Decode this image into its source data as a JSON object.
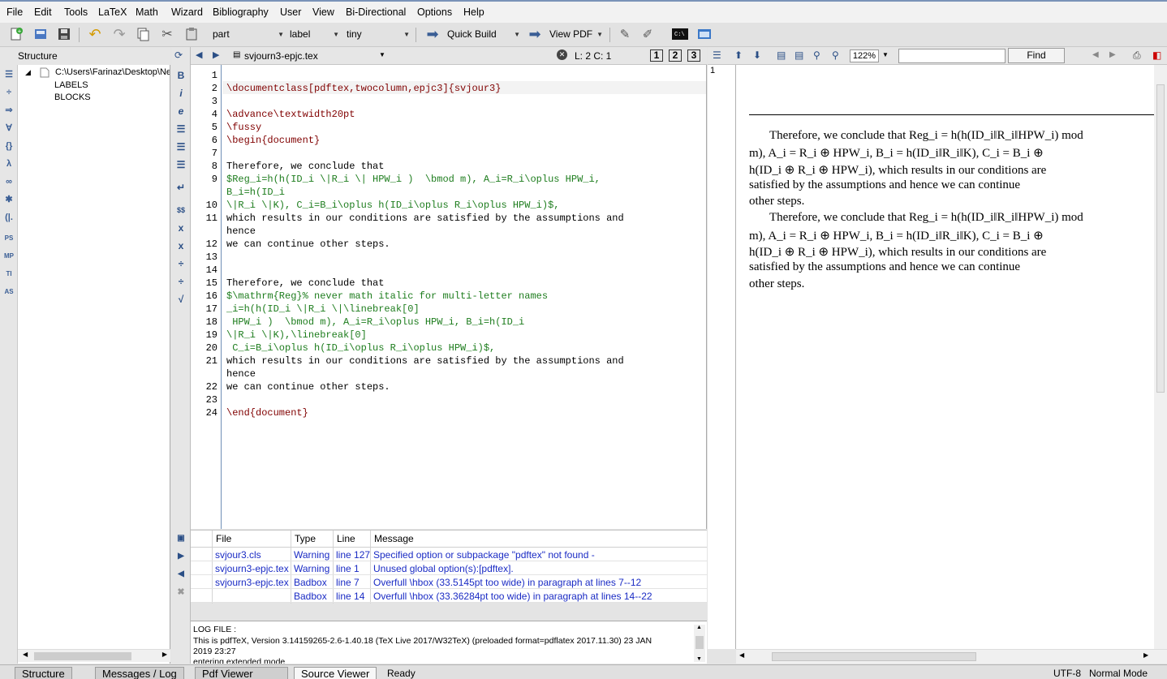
{
  "menu": [
    "File",
    "Edit",
    "Tools",
    "LaTeX",
    "Math",
    "Wizard",
    "Bibliography",
    "User",
    "View",
    "Bi-Directional",
    "Options",
    "Help"
  ],
  "toolbar": {
    "combo_part": "part",
    "combo_label": "label",
    "combo_size": "tiny",
    "quick_build": "Quick Build",
    "view_pdf": "View PDF"
  },
  "structure": {
    "title": "Structure",
    "root_path": "C:\\Users\\Farinaz\\Desktop\\Ne",
    "children": [
      "LABELS",
      "BLOCKS"
    ]
  },
  "editor": {
    "filename": "svjourn3-epjc.tex",
    "position": "L: 2 C: 1",
    "view_buttons": [
      "1",
      "2",
      "3"
    ],
    "lines": [
      {
        "n": "1",
        "text": ""
      },
      {
        "n": "2",
        "text": "\\documentclass[pdftex,twocolumn,epjc3]{svjour3}"
      },
      {
        "n": "3",
        "text": ""
      },
      {
        "n": "4",
        "text": "\\advance\\textwidth20pt"
      },
      {
        "n": "5",
        "text": "\\fussy"
      },
      {
        "n": "6",
        "text": "\\begin{document}"
      },
      {
        "n": "7",
        "text": ""
      },
      {
        "n": "8",
        "text": "Therefore, we conclude that"
      },
      {
        "n": "9",
        "text": "$Reg_i=h(h(ID_i \\|R_i \\| HPW_i )  \\bmod m), A_i=R_i\\oplus HPW_i,"
      },
      {
        "n": "",
        "text": "B_i=h(ID_i"
      },
      {
        "n": "10",
        "text": "\\|R_i \\|K), C_i=B_i\\oplus h(ID_i\\oplus R_i\\oplus HPW_i)$,"
      },
      {
        "n": "11",
        "text": "which results in our conditions are satisfied by the assumptions and"
      },
      {
        "n": "",
        "text": "hence"
      },
      {
        "n": "12",
        "text": "we can continue other steps."
      },
      {
        "n": "13",
        "text": ""
      },
      {
        "n": "14",
        "text": ""
      },
      {
        "n": "15",
        "text": "Therefore, we conclude that"
      },
      {
        "n": "16",
        "text": "$\\mathrm{Reg}% never math italic for multi-letter names"
      },
      {
        "n": "17",
        "text": "_i=h(h(ID_i \\|R_i \\|\\linebreak[0]"
      },
      {
        "n": "18",
        "text": " HPW_i )  \\bmod m), A_i=R_i\\oplus HPW_i, B_i=h(ID_i"
      },
      {
        "n": "19",
        "text": "\\|R_i \\|K),\\linebreak[0]"
      },
      {
        "n": "20",
        "text": " C_i=B_i\\oplus h(ID_i\\oplus R_i\\oplus HPW_i)$,"
      },
      {
        "n": "21",
        "text": "which results in our conditions are satisfied by the assumptions and"
      },
      {
        "n": "",
        "text": "hence"
      },
      {
        "n": "22",
        "text": "we can continue other steps."
      },
      {
        "n": "23",
        "text": ""
      },
      {
        "n": "24",
        "text": "\\end{document}"
      }
    ]
  },
  "messages": {
    "headers": [
      "File",
      "Type",
      "Line",
      "Message"
    ],
    "rows": [
      {
        "file": "svjour3.cls",
        "type": "Warning",
        "line": "line 127",
        "message": "Specified option or subpackage \"pdftex\" not found -"
      },
      {
        "file": "svjourn3-epjc.tex",
        "type": "Warning",
        "line": "line 1",
        "message": "Unused global option(s):[pdftex]."
      },
      {
        "file": "svjourn3-epjc.tex",
        "type": "Badbox",
        "line": "line 7",
        "message": "Overfull \\hbox (33.5145pt too wide) in paragraph at lines 7--12"
      },
      {
        "file": "",
        "type": "Badbox",
        "line": "line 14",
        "message": "Overfull \\hbox (33.36284pt too wide) in paragraph at lines 14--22"
      }
    ]
  },
  "log": {
    "title": "LOG FILE :",
    "line1": "This is pdfTeX, Version 3.14159265-2.6-1.40.18 (TeX Live 2017/W32TeX) (preloaded format=pdflatex 2017.11.30) 23 JAN",
    "line2": "2019 23:27",
    "line3": "entering extended mode"
  },
  "pdf": {
    "zoom": "122%",
    "find_label": "Find",
    "page_number": "1",
    "para1": [
      [
        "Therefore, we conclude that ",
        "Reg",
        "i",
        " = ",
        "h",
        "(",
        "h",
        "(",
        "ID",
        "i",
        "‖",
        "R",
        "i",
        "‖",
        "HPW",
        "i",
        ") mod"
      ],
      "m), A_i = R_i ⊕ HPW_i, B_i = h(ID_i‖R_i‖K), C_i = B_i ⊕",
      "h(ID_i ⊕ R_i ⊕ HPW_i), which results in our conditions are",
      "satisfied by the assumptions and hence we can continue",
      "other steps."
    ],
    "text": {
      "p1l1": "Therefore, we conclude that Reg_i = h(h(ID_i‖R_i‖HPW_i) mod",
      "p1l2": "m), A_i = R_i ⊕ HPW_i, B_i = h(ID_i‖R_i‖K), C_i = B_i ⊕",
      "p1l3": "h(ID_i ⊕ R_i ⊕ HPW_i), which results in our conditions are",
      "p1l4": "satisfied by the assumptions and hence we can continue",
      "p1l5": "other steps.",
      "p2l1": "Therefore, we conclude that Reg_i = h(h(ID_i‖R_i‖HPW_i) mod",
      "p2l2": "m), A_i = R_i ⊕ HPW_i, B_i = h(ID_i‖R_i‖K), C_i = B_i ⊕",
      "p2l3": "h(ID_i ⊕ R_i ⊕ HPW_i), which results in our conditions are",
      "p2l4": "satisfied by the assumptions and hence we can continue",
      "p2l5": "other steps."
    }
  },
  "statusbar": {
    "tabs": [
      "Structure",
      "Messages / Log",
      "Pdf Viewer",
      "Source Viewer"
    ],
    "ready": "Ready",
    "encoding": "UTF-8",
    "mode": "Normal Mode"
  }
}
